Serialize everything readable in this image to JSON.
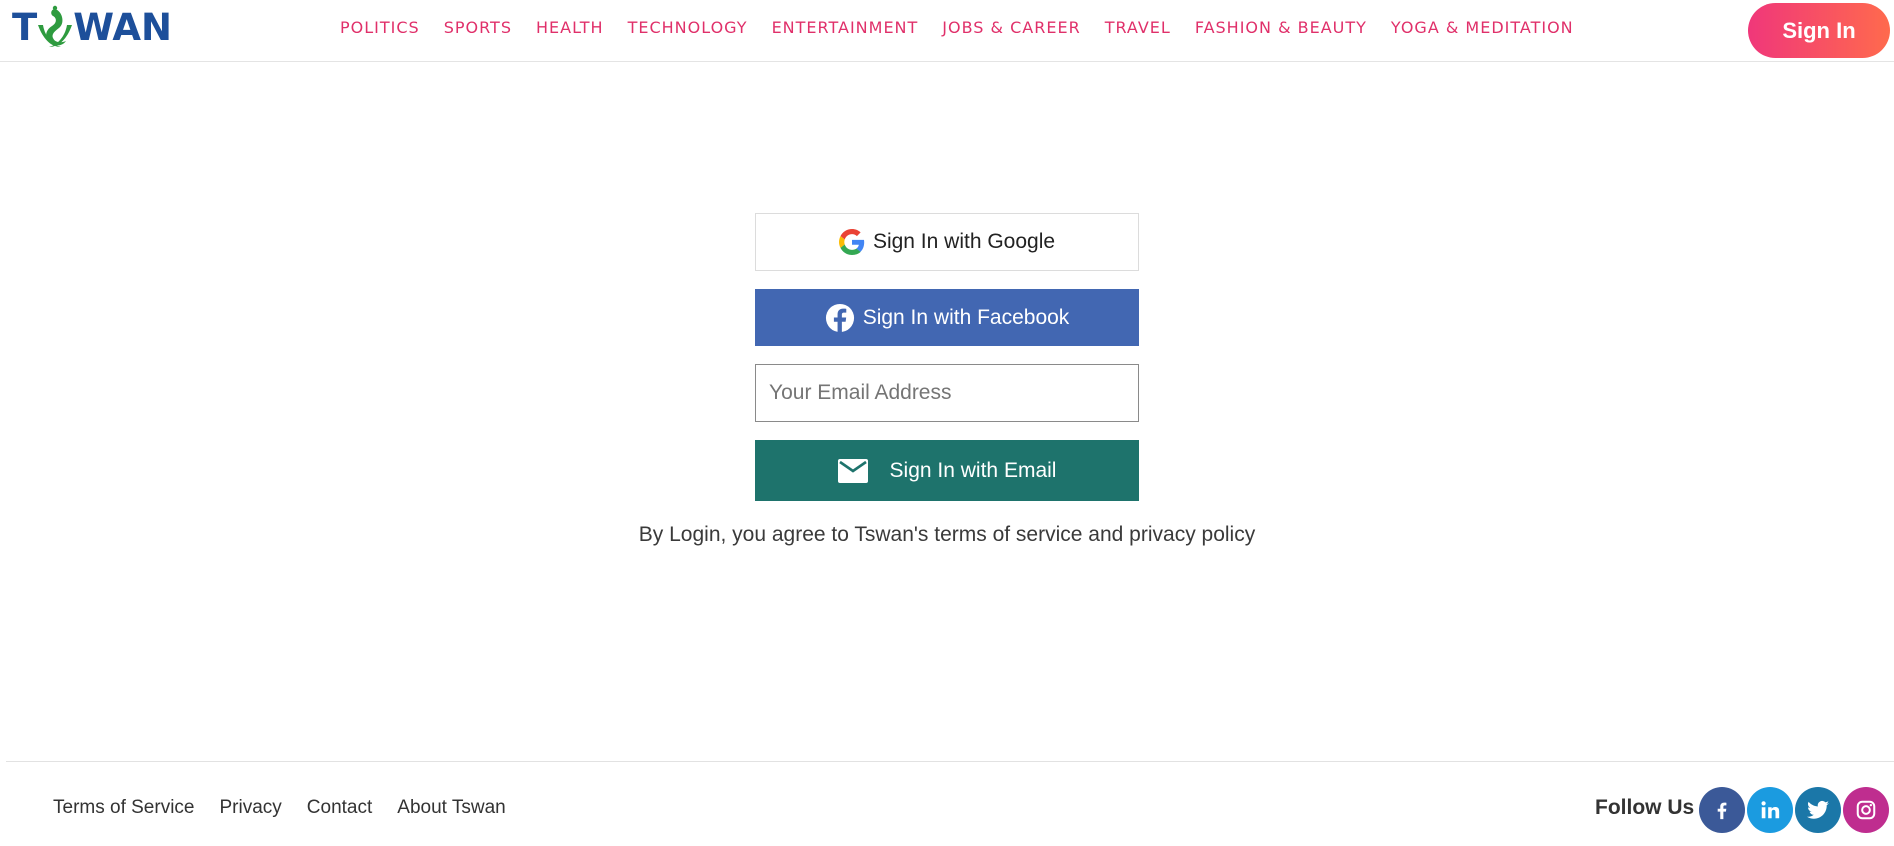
{
  "header": {
    "logo_text_left": "T",
    "logo_text_right": "WAN",
    "nav": [
      "POLITICS",
      "SPORTS",
      "HEALTH",
      "TECHNOLOGY",
      "ENTERTAINMENT",
      "JOBS & CAREER",
      "TRAVEL",
      "FASHION & BEAUTY",
      "YOGA & MEDITATION"
    ],
    "signin_label": "Sign In"
  },
  "form": {
    "google_label": "Sign In with Google",
    "facebook_label": "Sign In with Facebook",
    "email_placeholder": "Your Email Address",
    "email_button_label": "Sign In with Email"
  },
  "agreement": {
    "prefix": "By Login, you agree to Tswan's ",
    "terms_link": "terms of service",
    "and": " and ",
    "privacy_link": "privacy policy"
  },
  "footer": {
    "links": [
      "Terms of Service",
      "Privacy",
      "Contact",
      "About Tswan"
    ],
    "follow_label": "Follow Us",
    "social": [
      "facebook-icon",
      "linkedin-icon",
      "twitter-icon",
      "instagram-icon"
    ]
  },
  "colors": {
    "nav_accent": "#e0306a",
    "logo_blue": "#1d4f9a",
    "logo_green": "#2e9b3f",
    "facebook_blue": "#4267b2",
    "email_teal": "#1e736c"
  }
}
